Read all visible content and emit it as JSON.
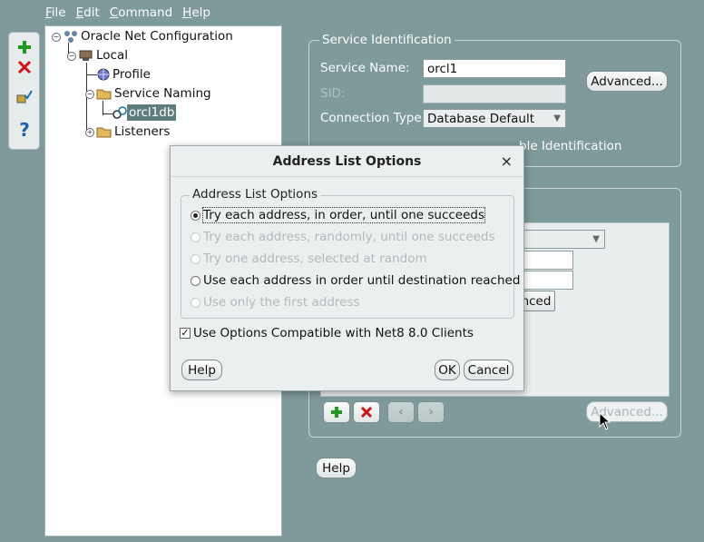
{
  "menu": {
    "file": {
      "underline": "F",
      "rest": "ile"
    },
    "edit": {
      "underline": "E",
      "rest": "dit"
    },
    "command": {
      "underline": "C",
      "rest": "ommand"
    },
    "help": {
      "underline": "H",
      "rest": "elp"
    }
  },
  "toolbar": {
    "icons": [
      "plus-icon",
      "delete-icon",
      "test-icon",
      "help-icon"
    ]
  },
  "tree": {
    "root": "Oracle Net Configuration",
    "local": "Local",
    "profile": "Profile",
    "service_naming": "Service Naming",
    "selected_service": "orcl1db",
    "listeners": "Listeners"
  },
  "service_identification": {
    "title": "Service Identification",
    "service_name_label": "Service Name:",
    "service_name_value": "orcl1",
    "sid_label": "SID:",
    "connection_type_label": "Connection Type:",
    "connection_type_value": "Database Default",
    "advanced_button": "Advanced...",
    "compat_checkbox_tail": "ble Identification"
  },
  "address_panel": {
    "advanced_partial": "nced",
    "advanced_button": "Advanced..."
  },
  "help_button": "Help",
  "dialog": {
    "title": "Address List Options",
    "close": "×",
    "group_title": "Address List Options",
    "options": [
      "Try each address, in order, until one succeeds",
      "Try each address, randomly, until one succeeds",
      "Try one address, selected at random",
      "Use each address in order until destination reached",
      "Use only the first address"
    ],
    "compat_checkbox": "Use Options Compatible with Net8 8.0 Clients",
    "help_button": "Help",
    "ok_button": "OK",
    "cancel_button": "Cancel"
  },
  "colors": {
    "background": "#7e9a9a",
    "selected": "#5e7e7e",
    "add_green": "#1e9a1e",
    "delete_red": "#d01010"
  }
}
